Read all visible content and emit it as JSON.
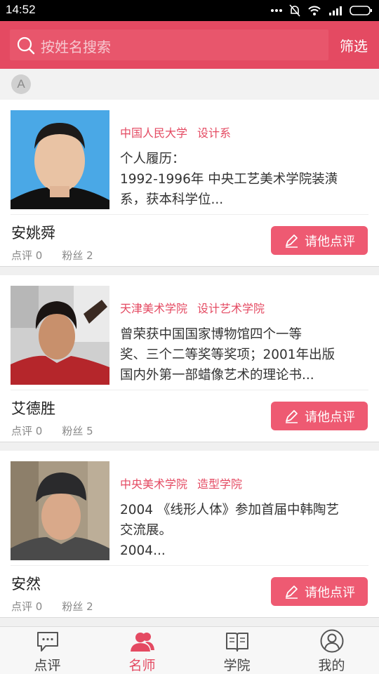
{
  "status_bar": {
    "time": "14:52"
  },
  "search": {
    "placeholder": "按姓名搜索",
    "filter_label": "筛选"
  },
  "section": {
    "letter": "A"
  },
  "teachers": [
    {
      "school": "中国人民大学",
      "department": "设计系",
      "bio_lines": [
        "个人履历：",
        "1992-1996年  中央工艺美术学院装潢",
        "系，获本科学位..."
      ],
      "name": "安姚舜",
      "reviews": "点评 0",
      "fans": "粉丝 2",
      "button": "请他点评"
    },
    {
      "school": "天津美术学院",
      "department": "设计艺术学院",
      "bio_lines": [
        "曾荣获中国国家博物馆四个一等",
        "奖、三个二等奖等奖项；2001年出版",
        "国内外第一部蜡像艺术的理论书..."
      ],
      "name": "艾德胜",
      "reviews": "点评 0",
      "fans": "粉丝 5",
      "button": "请他点评"
    },
    {
      "school": "中央美术学院",
      "department": "造型学院",
      "bio_lines": [
        "2004 《线形人体》参加首届中韩陶艺",
        "交流展。",
        "2004..."
      ],
      "name": "安然",
      "reviews": "点评 0",
      "fans": "粉丝 2",
      "button": "请他点评"
    }
  ],
  "tabs": [
    {
      "label": "点评",
      "icon": "comment-icon",
      "active": false
    },
    {
      "label": "名师",
      "icon": "people-icon",
      "active": true
    },
    {
      "label": "学院",
      "icon": "book-icon",
      "active": false
    },
    {
      "label": "我的",
      "icon": "user-icon",
      "active": false
    }
  ],
  "colors": {
    "accent": "#e44a62",
    "button": "#ee5a72"
  }
}
